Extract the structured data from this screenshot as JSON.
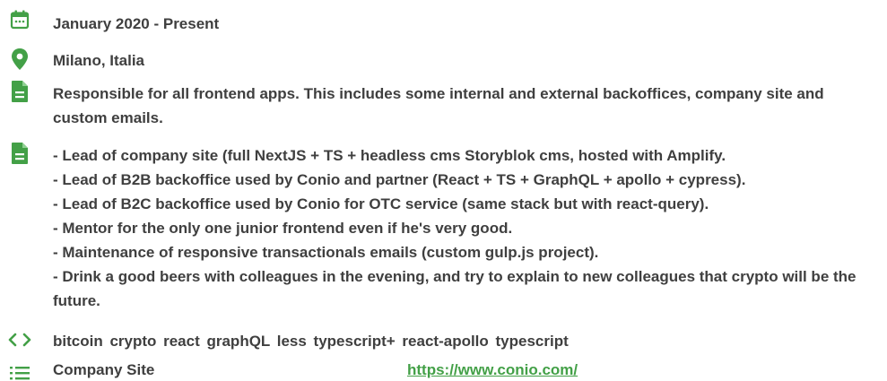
{
  "colors": {
    "accent": "#43a047",
    "text": "#3f3f3f"
  },
  "date": {
    "icon": "calendar-icon",
    "text": "January 2020 - Present"
  },
  "location": {
    "icon": "map-pin-icon",
    "text": "Milano, Italia"
  },
  "summary": {
    "icon": "document-icon",
    "text": "Responsible for all frontend apps. This includes some internal and external backoffices, company site and custom emails."
  },
  "duties": {
    "icon": "document-icon",
    "items": [
      "- Lead of company site (full NextJS + TS + headless cms Storyblok cms, hosted with Amplify.",
      "- Lead of B2B backoffice used by Conio and partner (React + TS + GraphQL + apollo + cypress).",
      "- Lead of B2C backoffice used by Conio for OTC service (same stack but with react-query).",
      "- Mentor for the only one junior frontend even if he's very good.",
      "- Maintenance of responsive transactionals emails (custom gulp.js project).",
      "- Drink a good beers with colleagues in the evening, and try to explain to new colleagues that crypto will be the future."
    ]
  },
  "tags": {
    "icon": "code-icon",
    "text": "bitcoin crypto react graphQL less typescript+ react-apollo typescript"
  },
  "links": {
    "icon": "list-icon",
    "items": [
      {
        "label": "Company Site",
        "url": "https://www.conio.com/"
      }
    ]
  }
}
